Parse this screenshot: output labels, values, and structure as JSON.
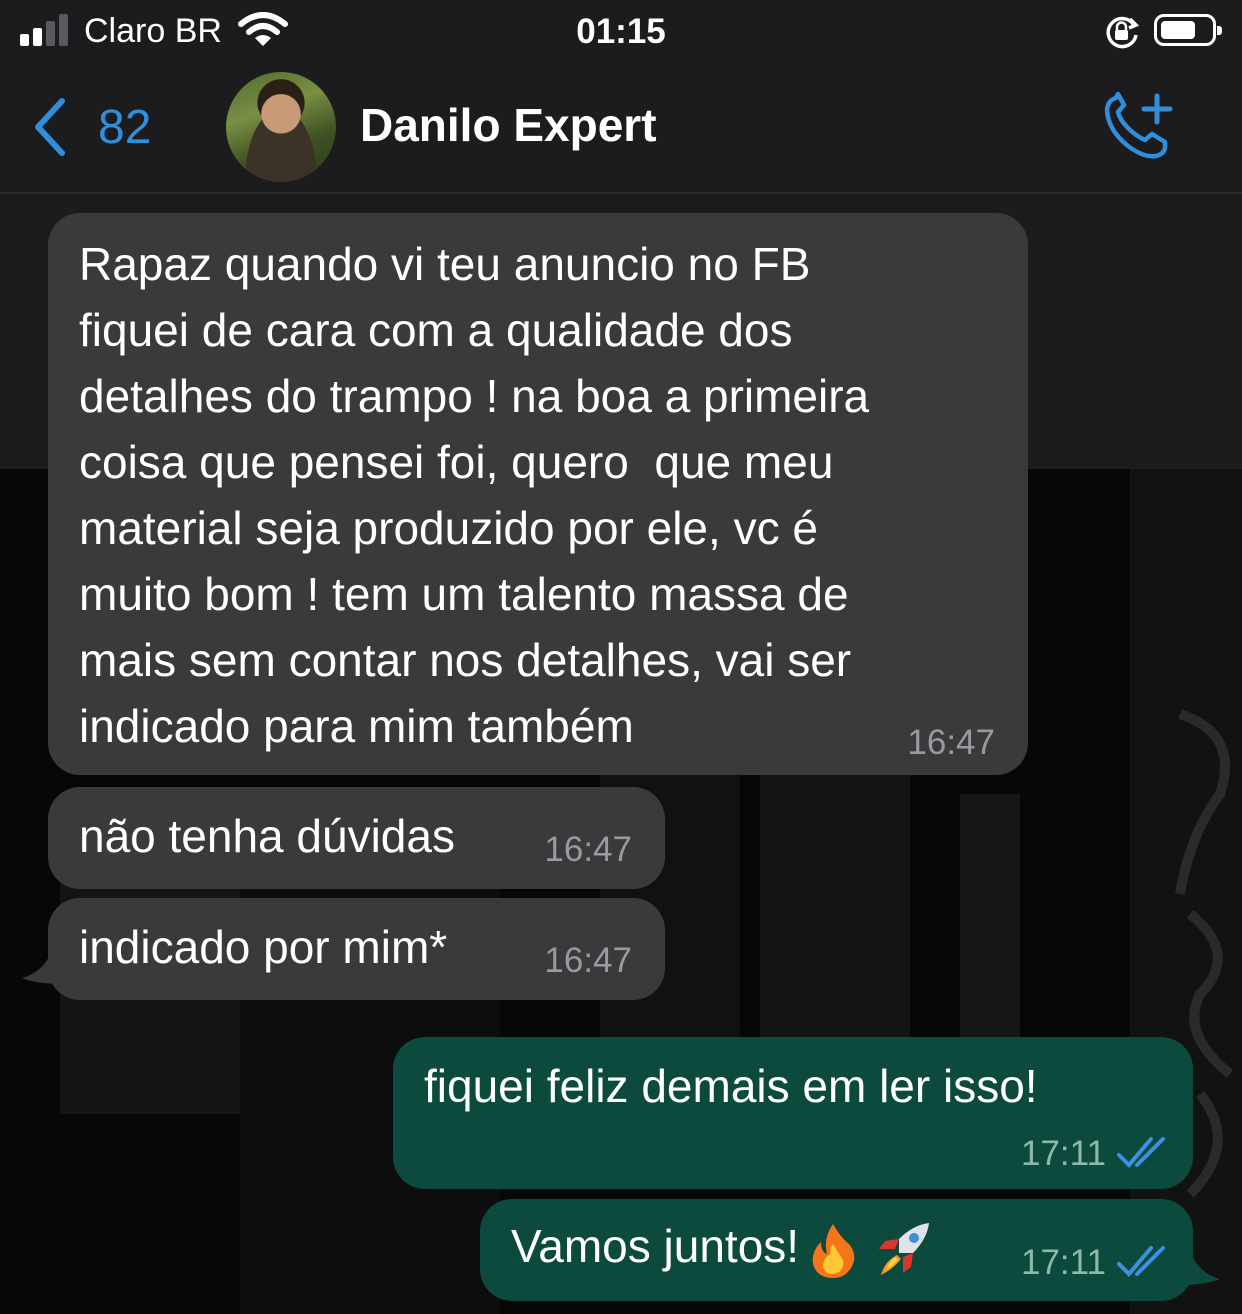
{
  "status_bar": {
    "carrier": "Claro BR",
    "time": "01:15",
    "battery_level": 0.7
  },
  "header": {
    "back_count": "82",
    "contact_name": "Danilo Expert"
  },
  "messages": [
    {
      "direction": "incoming",
      "text": "Rapaz quando vi teu anuncio no FB\nfiquei de cara com a qualidade dos\ndetalhes do trampo ! na boa a primeira\ncoisa que pensei foi, quero  que meu\nmaterial seja produzido por ele, vc é\nmuito bom ! tem um talento massa de\nmais sem contar nos detalhes, vai ser\nindicado para mim também",
      "time": "16:47"
    },
    {
      "direction": "incoming",
      "text": "não tenha dúvidas",
      "time": "16:47"
    },
    {
      "direction": "incoming",
      "text": "indicado por mim*",
      "time": "16:47"
    },
    {
      "direction": "outgoing",
      "text": "fiquei feliz demais em ler isso!",
      "time": "17:11",
      "status": "read"
    },
    {
      "direction": "outgoing",
      "text": "Vamos juntos!",
      "emojis": [
        "fire-emoji",
        "rocket-emoji"
      ],
      "time": "17:11",
      "status": "read"
    }
  ],
  "colors": {
    "accent": "#2f8fdd",
    "incoming_bubble": "#3a3a3c",
    "outgoing_bubble": "#0b4a3c",
    "read_ticks": "#3d8fe0"
  }
}
